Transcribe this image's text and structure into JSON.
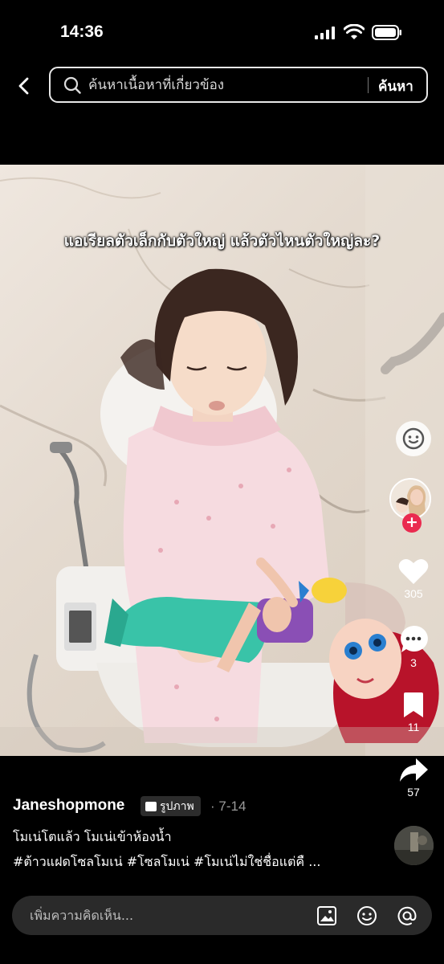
{
  "status_bar": {
    "time": "14:36"
  },
  "search": {
    "placeholder": "ค้นหาเนื้อหาที่เกี่ยวข้อง",
    "button_label": "ค้นหา"
  },
  "photo": {
    "overlay_caption": "แอเรียลตัวเล็กกับตัวใหญ่ แล้วตัวไหนตัวใหญ่ละ?"
  },
  "rail": {
    "likes": "305",
    "comments": "3",
    "saves": "11",
    "shares": "57"
  },
  "post": {
    "author": "Janeshopmone",
    "type_badge": "รูปภาพ",
    "date": "· 7-14",
    "title": "โมเน่โตแล้ว โมเน่เข้าห้องน้ำ",
    "tags": "#ต้าวแฝดโซลโมเน่ #โซลโมเน่ #โมเน่ไม่ใช่ชื่อแต่คื ..."
  },
  "comment_bar": {
    "placeholder": "เพิ่มความคิดเห็น..."
  },
  "colors": {
    "accent_red": "#ea2a4f",
    "background": "#000000",
    "comment_bar": "#2a2a2a"
  },
  "icons": [
    "back-arrow-icon",
    "search-icon",
    "face-icon",
    "plus-icon",
    "heart-icon",
    "comment-icon",
    "bookmark-icon",
    "share-icon",
    "image-icon",
    "emoji-icon",
    "mention-icon"
  ]
}
